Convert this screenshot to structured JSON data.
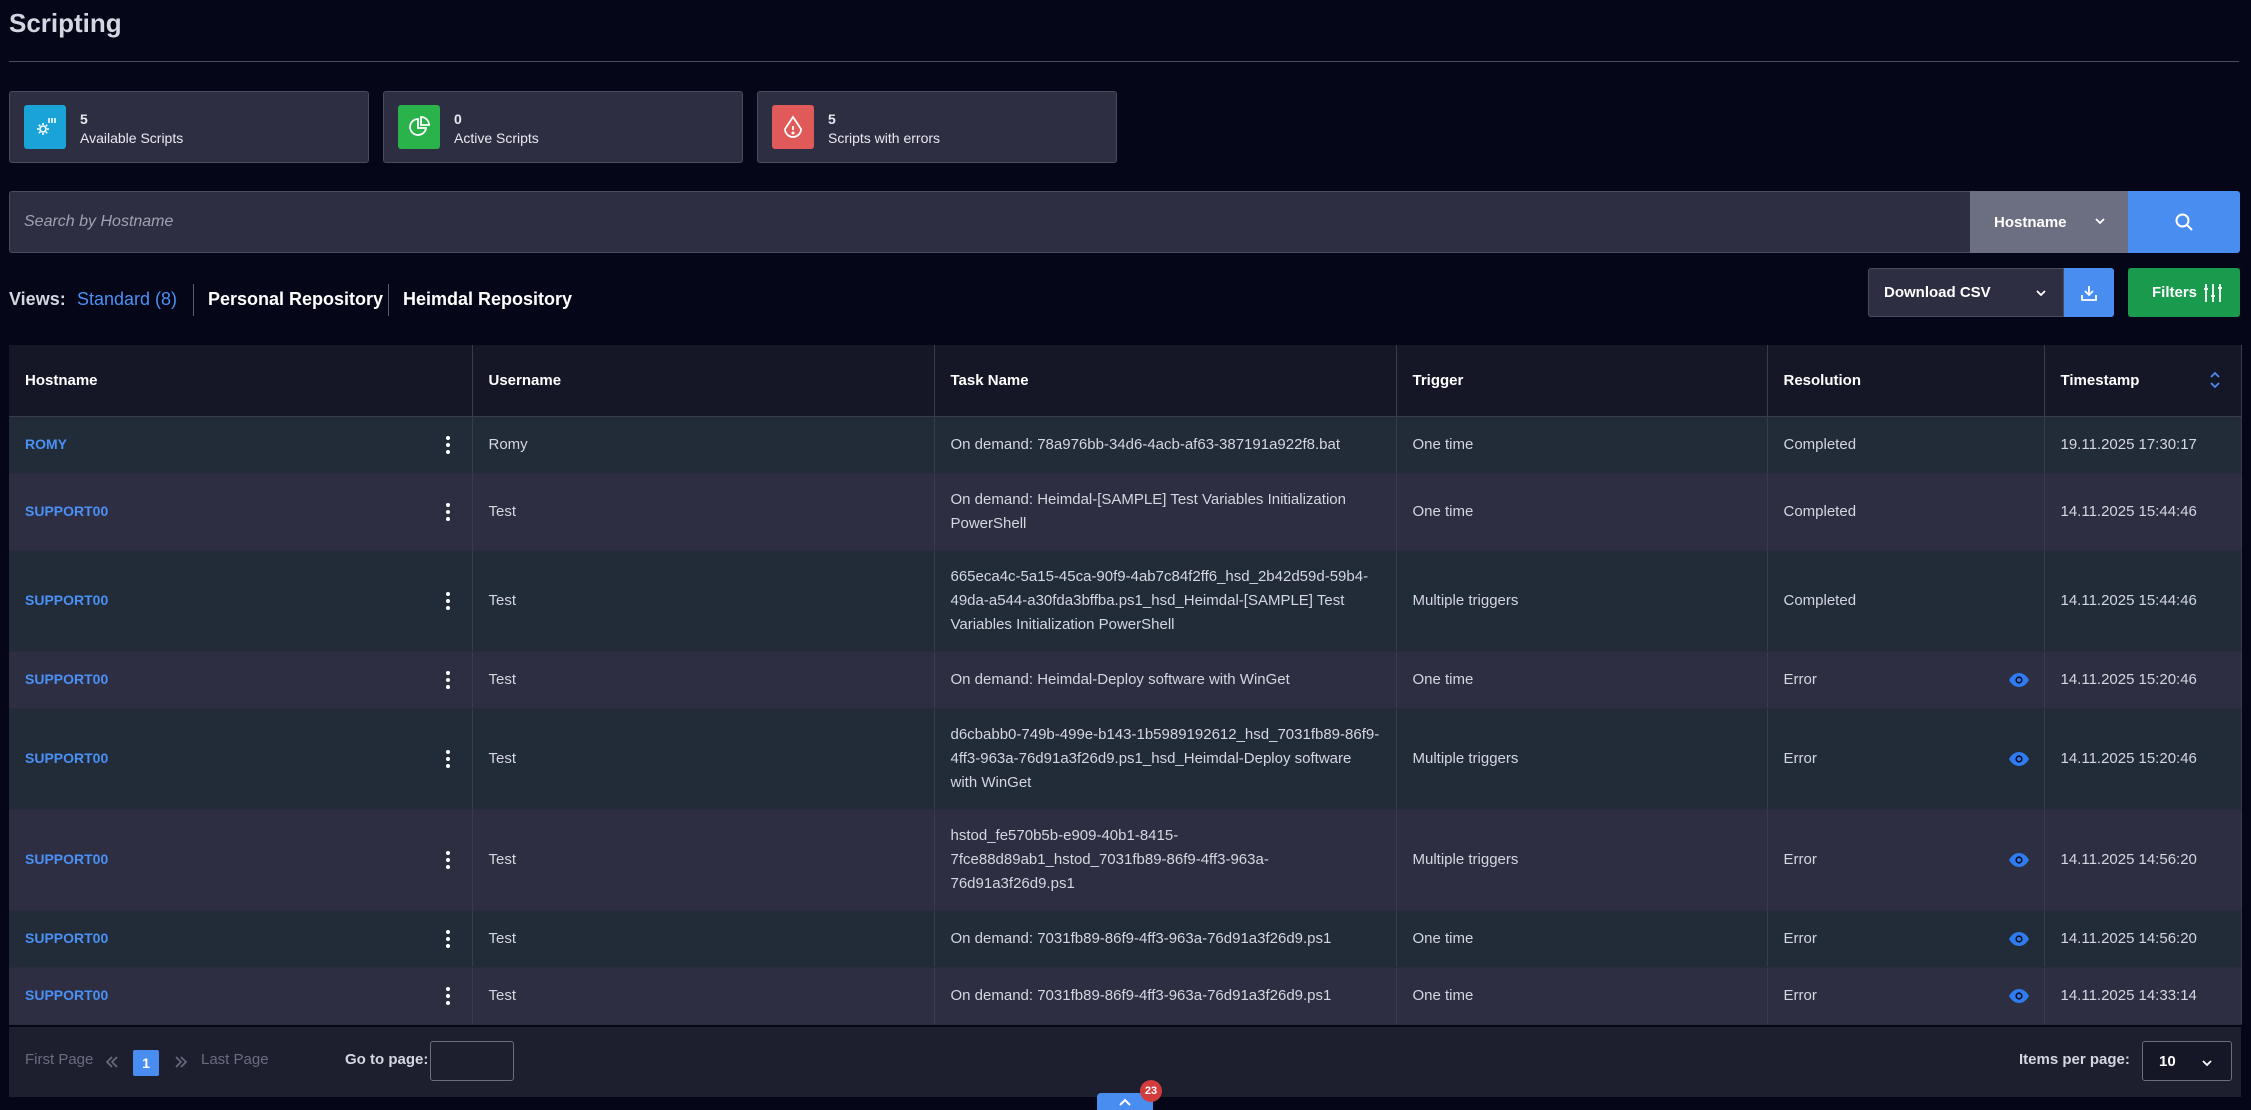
{
  "page": {
    "title": "Scripting"
  },
  "stats": [
    {
      "value": "5",
      "label": "Available Scripts",
      "icon": "script-gear-icon",
      "color": "#1aa3d6"
    },
    {
      "value": "0",
      "label": "Active Scripts",
      "icon": "pie-chart-icon",
      "color": "#29b34a"
    },
    {
      "value": "5",
      "label": "Scripts with errors",
      "icon": "error-drop-icon",
      "color": "#e05a5a"
    }
  ],
  "search": {
    "placeholder": "Search by Hostname",
    "field": "Hostname"
  },
  "views": {
    "label": "Views:",
    "standard": "Standard (8)",
    "personal": "Personal Repository",
    "heimdal": "Heimdal Repository"
  },
  "toolbar": {
    "download_label": "Download CSV",
    "filters_label": "Filters"
  },
  "table": {
    "columns": [
      "Hostname",
      "Username",
      "Task Name",
      "Trigger",
      "Resolution",
      "Timestamp"
    ],
    "rows": [
      {
        "hostname": "ROMY",
        "username": "Romy",
        "task": "On demand: 78a976bb-34d6-4acb-af63-387191a922f8.bat",
        "trigger": "One time",
        "resolution": "Completed",
        "date": "19.11.2025",
        "time": "17:30:17",
        "eye": false
      },
      {
        "hostname": "SUPPORT00",
        "username": "Test",
        "task": "On demand: Heimdal-[SAMPLE] Test Variables Initialization PowerShell",
        "trigger": "One time",
        "resolution": "Completed",
        "date": "14.11.2025",
        "time": "15:44:46",
        "eye": false
      },
      {
        "hostname": "SUPPORT00",
        "username": "Test",
        "task": "665eca4c-5a15-45ca-90f9-4ab7c84f2ff6_hsd_2b42d59d-59b4-49da-a544-a30fda3bffba.ps1_hsd_Heimdal-[SAMPLE] Test Variables Initialization PowerShell",
        "trigger": "Multiple triggers",
        "resolution": "Completed",
        "date": "14.11.2025",
        "time": "15:44:46",
        "eye": false
      },
      {
        "hostname": "SUPPORT00",
        "username": "Test",
        "task": "On demand: Heimdal-Deploy software with WinGet",
        "trigger": "One time",
        "resolution": "Error",
        "date": "14.11.2025",
        "time": "15:20:46",
        "eye": true
      },
      {
        "hostname": "SUPPORT00",
        "username": "Test",
        "task": "d6cbabb0-749b-499e-b143-1b5989192612_hsd_7031fb89-86f9-4ff3-963a-76d91a3f26d9.ps1_hsd_Heimdal-Deploy software with WinGet",
        "trigger": "Multiple triggers",
        "resolution": "Error",
        "date": "14.11.2025",
        "time": "15:20:46",
        "eye": true
      },
      {
        "hostname": "SUPPORT00",
        "username": "Test",
        "task": "hstod_fe570b5b-e909-40b1-8415-7fce88d89ab1_hstod_7031fb89-86f9-4ff3-963a-76d91a3f26d9.ps1",
        "trigger": "Multiple triggers",
        "resolution": "Error",
        "date": "14.11.2025",
        "time": "14:56:20",
        "eye": true
      },
      {
        "hostname": "SUPPORT00",
        "username": "Test",
        "task": "On demand: 7031fb89-86f9-4ff3-963a-76d91a3f26d9.ps1",
        "trigger": "One time",
        "resolution": "Error",
        "date": "14.11.2025",
        "time": "14:56:20",
        "eye": true
      },
      {
        "hostname": "SUPPORT00",
        "username": "Test",
        "task": "On demand: 7031fb89-86f9-4ff3-963a-76d91a3f26d9.ps1",
        "trigger": "One time",
        "resolution": "Error",
        "date": "14.11.2025",
        "time": "14:33:14",
        "eye": true
      }
    ]
  },
  "pagination": {
    "first": "First Page",
    "current": "1",
    "last": "Last Page",
    "goto": "Go to page:",
    "items_per_page_label": "Items per page:",
    "items_per_page": "10"
  },
  "notification": {
    "count": "23"
  },
  "colors": {
    "accent": "#4a8df0",
    "success": "#1a9a4c",
    "background": "#050618"
  }
}
